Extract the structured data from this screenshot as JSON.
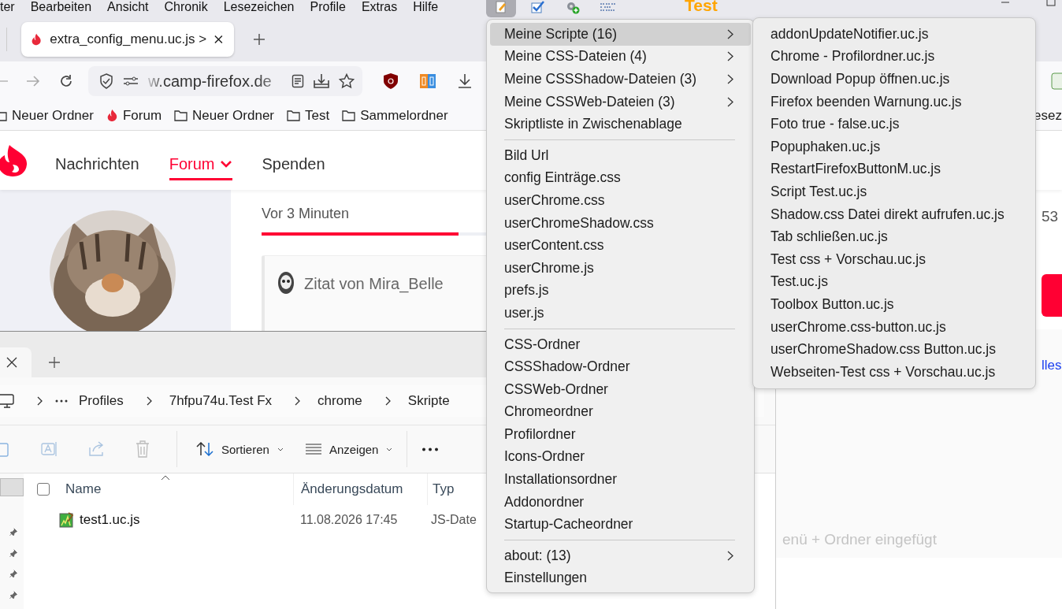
{
  "menubar": [
    "ter",
    "Bearbeiten",
    "Ansicht",
    "Chronik",
    "Lesezeichen",
    "Profile",
    "Extras",
    "Hilfe"
  ],
  "title_label": "Test",
  "tab": {
    "title": "extra_config_menu.uc.js >",
    "selected": true
  },
  "url": {
    "host": "w.camp-firefox.de"
  },
  "bookmarks": [
    {
      "label": "Neuer Ordner",
      "kind": "folder"
    },
    {
      "label": "Forum",
      "kind": "site"
    },
    {
      "label": "Neuer Ordner",
      "kind": "folder"
    },
    {
      "label": "Test",
      "kind": "folder"
    },
    {
      "label": "Sammelordner",
      "kind": "folder"
    }
  ],
  "bookmark_right": "esez",
  "forum": {
    "nav": [
      {
        "label": "Nachrichten",
        "selected": false,
        "dropdown": false
      },
      {
        "label": "Forum",
        "selected": true,
        "dropdown": true
      },
      {
        "label": "Spenden",
        "selected": false,
        "dropdown": false
      }
    ],
    "time_tab": "Vor 3 Minuten",
    "quote": "Zitat von Mira_Belle",
    "count": "53",
    "link": "lles",
    "faded_note": "enü + Ordner eingefügt"
  },
  "explorer": {
    "breadcrumb": [
      "Profiles",
      "7hfpu74u.Test Fx",
      "chrome",
      "Skripte"
    ],
    "actions": [
      "Sortieren",
      "Anzeigen"
    ],
    "columns": [
      "Name",
      "Änderungsdatum",
      "Typ"
    ],
    "select_all": {
      "checked": false
    },
    "rows": [
      {
        "name": "test1.uc.js",
        "date": "11.08.2026 17:45",
        "type": "JS-Date"
      }
    ]
  },
  "menu": [
    {
      "kind": "submenu",
      "label": "Meine Scripte (16)",
      "selected": true
    },
    {
      "kind": "submenu",
      "label": "Meine CSS-Dateien (4)",
      "selected": false
    },
    {
      "kind": "submenu",
      "label": "Meine CSSShadow-Dateien (3)",
      "selected": false
    },
    {
      "kind": "submenu",
      "label": "Meine CSSWeb-Dateien (3)",
      "selected": false
    },
    {
      "kind": "item",
      "label": "Skriptliste in Zwischenablage",
      "selected": false
    },
    {
      "kind": "separator"
    },
    {
      "kind": "item",
      "label": "Bild Url",
      "selected": false
    },
    {
      "kind": "item",
      "label": "config Einträge.css",
      "selected": false
    },
    {
      "kind": "item",
      "label": "userChrome.css",
      "selected": false
    },
    {
      "kind": "item",
      "label": "userChromeShadow.css",
      "selected": false
    },
    {
      "kind": "item",
      "label": "userContent.css",
      "selected": false
    },
    {
      "kind": "item",
      "label": "userChrome.js",
      "selected": false
    },
    {
      "kind": "item",
      "label": "prefs.js",
      "selected": false
    },
    {
      "kind": "item",
      "label": "user.js",
      "selected": false
    },
    {
      "kind": "separator"
    },
    {
      "kind": "item",
      "label": "CSS-Ordner",
      "selected": false
    },
    {
      "kind": "item",
      "label": "CSSShadow-Ordner",
      "selected": false
    },
    {
      "kind": "item",
      "label": "CSSWeb-Ordner",
      "selected": false
    },
    {
      "kind": "item",
      "label": "Chromeordner",
      "selected": false
    },
    {
      "kind": "item",
      "label": "Profilordner",
      "selected": false
    },
    {
      "kind": "item",
      "label": "Icons-Ordner",
      "selected": false
    },
    {
      "kind": "item",
      "label": "Installationsordner",
      "selected": false
    },
    {
      "kind": "item",
      "label": "Addonordner",
      "selected": false
    },
    {
      "kind": "item",
      "label": "Startup-Cacheordner",
      "selected": false
    },
    {
      "kind": "separator"
    },
    {
      "kind": "submenu",
      "label": "about: (13)",
      "selected": false
    },
    {
      "kind": "item",
      "label": "Einstellungen",
      "selected": false
    }
  ],
  "submenu": [
    "addonUpdateNotifier.uc.js",
    "Chrome - Profilordner.uc.js",
    "Download Popup öffnen.uc.js",
    "Firefox beenden Warnung.uc.js",
    "Foto true - false.uc.js",
    "Popuphaken.uc.js",
    "RestartFirefoxButtonM.uc.js",
    "Script Test.uc.js",
    "Shadow.css Datei direkt aufrufen.uc.js",
    "Tab schließen.uc.js",
    "Test css + Vorschau.uc.js",
    "Test.uc.js",
    "Toolbox Button.uc.js",
    "userChrome.css-button.uc.js",
    "userChromeShadow.css Button.uc.js",
    "Webseiten-Test css + Vorschau.uc.js"
  ]
}
